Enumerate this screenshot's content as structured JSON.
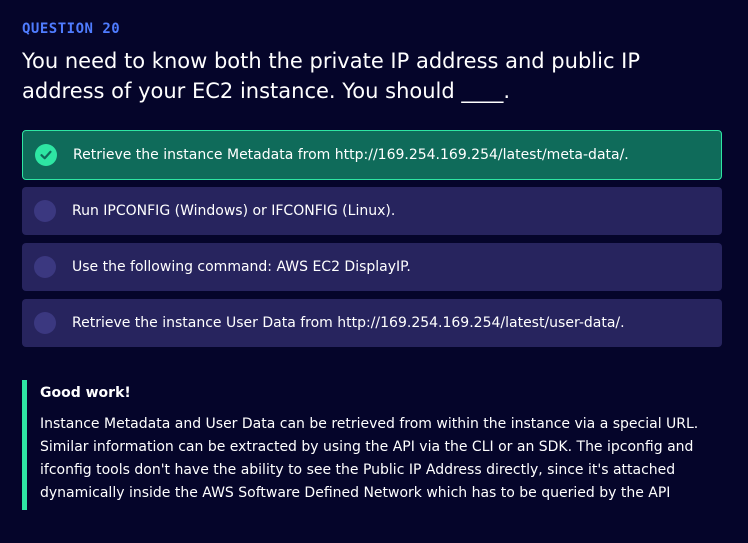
{
  "question": {
    "number_label": "QUESTION 20",
    "text": "You need to know both the private IP address and public IP address of your EC2 instance. You should ____."
  },
  "options": [
    {
      "label": "Retrieve the instance Metadata from http://169.254.169.254/latest/meta-data/.",
      "selected": true,
      "correct": true
    },
    {
      "label": "Run IPCONFIG (Windows) or IFCONFIG (Linux).",
      "selected": false
    },
    {
      "label": "Use the following command: AWS EC2 DisplayIP.",
      "selected": false
    },
    {
      "label": "Retrieve the instance User Data from http://169.254.169.254/latest/user-data/.",
      "selected": false
    }
  ],
  "feedback": {
    "title": "Good work!",
    "text": "Instance Metadata and User Data can be retrieved from within the instance via a special URL. Similar information can be extracted by using the API via the CLI or an SDK. The ipconfig and ifconfig tools don't have the ability to see the Public IP Address directly, since it's attached dynamically inside the AWS Software Defined Network which has to be queried by the API"
  },
  "colors": {
    "background": "#05052a",
    "accent_blue": "#4f7cff",
    "correct_green": "#2ee6a3",
    "correct_bg": "#0f6b5a",
    "option_bg": "#27245e"
  },
  "icons": {
    "correct_option": "check-circle-icon",
    "unselected_option": "radio-empty-icon"
  }
}
